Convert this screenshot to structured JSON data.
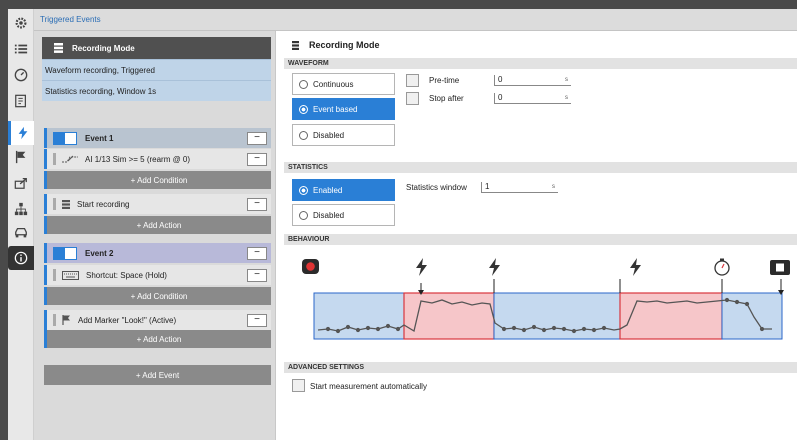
{
  "tab": {
    "title": "Triggered Events"
  },
  "rail": {
    "icons": [
      "gear-icon",
      "list-icon",
      "gauge-icon",
      "report-icon",
      "lightning-icon",
      "flag-icon",
      "export-icon",
      "network-icon",
      "car-icon",
      "info-icon"
    ]
  },
  "left_panel": {
    "recording_header": "Recording Mode",
    "modes": [
      "Waveform recording, Triggered",
      "Statistics recording, Window 1s"
    ],
    "events": [
      {
        "title": "Event 1",
        "condition": "AI 1/13 Sim >= 5 (rearm @ 0)",
        "add_condition": "+ Add Condition",
        "action": "Start recording",
        "add_action": "+ Add Action"
      },
      {
        "title": "Event 2",
        "condition": "Shortcut: Space (Hold)",
        "add_condition": "+ Add Condition",
        "action": "Add Marker \"Look!\" (Active)",
        "add_action": "+ Add Action"
      }
    ],
    "add_event": "+ Add Event"
  },
  "right_panel": {
    "title": "Recording Mode",
    "waveform": {
      "section": "WAVEFORM",
      "options": [
        "Continuous",
        "Event based",
        "Disabled"
      ],
      "selected": "Event based",
      "pretime_label": "Pre-time",
      "pretime_value": "0",
      "pretime_unit": "s",
      "stopafter_label": "Stop after",
      "stopafter_value": "0",
      "stopafter_unit": "s"
    },
    "statistics": {
      "section": "STATISTICS",
      "options": [
        "Enabled",
        "Disabled"
      ],
      "selected": "Enabled",
      "window_label": "Statistics window",
      "window_value": "1",
      "window_unit": "s"
    },
    "behaviour": {
      "section": "BEHAVIOUR"
    },
    "advanced": {
      "section": "ADVANCED SETTINGS",
      "start_auto_label": "Start measurement automatically"
    }
  },
  "colors": {
    "accent": "#2a7fd6",
    "record_fill": "#f6c6c9",
    "record_stroke": "#d9363e",
    "window_fill": "#c5d9ef",
    "window_stroke": "#2a66c9",
    "header_dark": "#505050"
  }
}
